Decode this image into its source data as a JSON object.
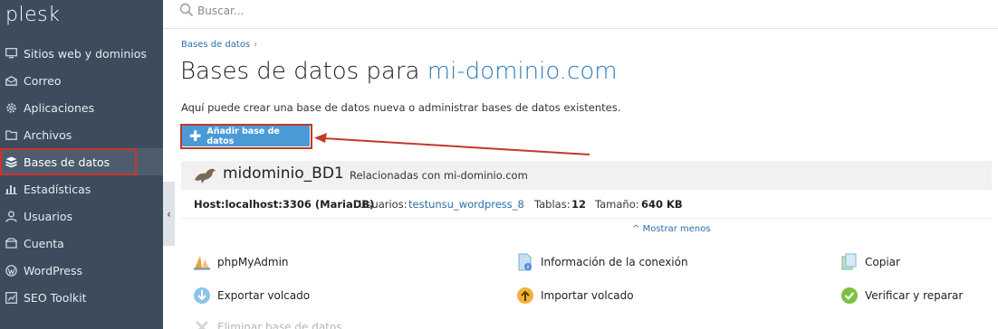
{
  "brand": {
    "logo_text": "plesk"
  },
  "search": {
    "placeholder": "Buscar..."
  },
  "sidebar": {
    "items": [
      {
        "label": "Sitios web y dominios",
        "icon": "monitor-icon",
        "active": false
      },
      {
        "label": "Correo",
        "icon": "mail-icon",
        "active": false
      },
      {
        "label": "Aplicaciones",
        "icon": "gear-icon",
        "active": false
      },
      {
        "label": "Archivos",
        "icon": "folder-icon",
        "active": false
      },
      {
        "label": "Bases de datos",
        "icon": "database-icon",
        "active": true
      },
      {
        "label": "Estadísticas",
        "icon": "bar-chart-icon",
        "active": false
      },
      {
        "label": "Usuarios",
        "icon": "user-icon",
        "active": false
      },
      {
        "label": "Cuenta",
        "icon": "account-icon",
        "active": false
      },
      {
        "label": "WordPress",
        "icon": "wordpress-icon",
        "active": false
      },
      {
        "label": "SEO Toolkit",
        "icon": "seo-icon",
        "active": false
      }
    ],
    "collapse_glyph": "‹"
  },
  "breadcrumb": {
    "label": "Bases de datos",
    "separator": "›"
  },
  "page": {
    "title_prefix": "Bases de datos para",
    "title_domain": "mi-dominio.com",
    "description": "Aquí puede crear una base de datos nueva o administrar bases de datos existentes."
  },
  "toolbar": {
    "add_label": "Añadir base de datos",
    "add_glyph": "✚"
  },
  "database": {
    "name": "midominio_BD1",
    "related": "Relacionadas con mi-dominio.com",
    "host_label": "Host:",
    "host_value": "localhost:3306 (MariaDB)",
    "users_label": "Usuarios:",
    "users_value": "testunsu_wordpress_8",
    "tables_label": "Tablas:",
    "tables_value": "12",
    "size_label": "Tamaño:",
    "size_value": "640 KB",
    "toggle_label": "Mostrar menos",
    "toggle_glyph": "^"
  },
  "actions": [
    {
      "label": "phpMyAdmin",
      "icon": "phpmyadmin-icon"
    },
    {
      "label": "Información de la conexión",
      "icon": "connection-info-icon"
    },
    {
      "label": "Copiar",
      "icon": "copy-icon"
    },
    {
      "label": "Exportar volcado",
      "icon": "export-icon"
    },
    {
      "label": "Importar volcado",
      "icon": "import-icon"
    },
    {
      "label": "Verificar y reparar",
      "icon": "check-icon"
    },
    {
      "label": "Eliminar base de datos",
      "icon": "delete-icon"
    }
  ],
  "colors": {
    "sidebar_bg": "#3d4c5c",
    "accent_blue": "#4a9ad6",
    "link_blue": "#2b6ea6",
    "highlight_red": "#c0392b"
  }
}
